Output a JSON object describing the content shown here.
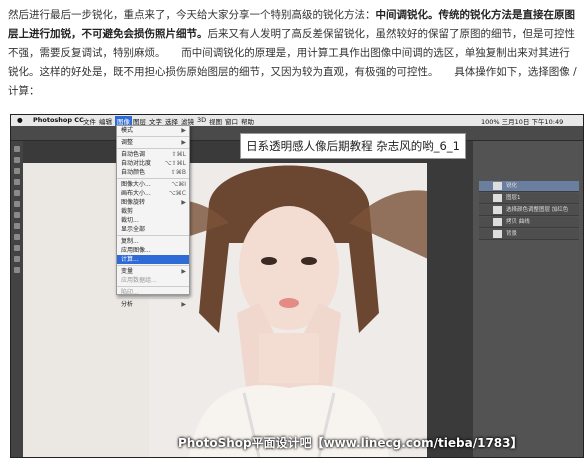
{
  "article": {
    "p1": "然后进行最后一步锐化，重点来了，今天给大家分享一个特别高级的锐化方法：",
    "p1_bold": "中间调锐化。",
    "p1_bold2": "传统的锐化方法是直接在原图层上进行加锐，不可避免会损伤照片细节。",
    "p2": "后来又有人发明了高反差保留锐化，虽然较好的保留了原图的细节，但是可控性不强，需要反复调试，特别麻烦。　　而中间调锐化的原理是，用计算工具作出图像中间调的选区，单独复制出来对其进行锐化。这样的好处是，既不用担心损伤原始图层的细节，又因为较为直观，有极强的可控性。　　具体操作如下，选择图像 / 计算："
  },
  "app": {
    "name": "Photoshop CC",
    "menus": [
      "文件",
      "编辑",
      "图像",
      "图层",
      "文字",
      "选择",
      "滤镜",
      "3D",
      "视图",
      "窗口",
      "帮助"
    ],
    "status_right": "100%  三月10日 下午10:49"
  },
  "image_menu": {
    "items": [
      {
        "label": "模式",
        "shortcut": "▶"
      },
      {
        "label": "调整",
        "shortcut": "▶"
      },
      {
        "label": "自动色调",
        "shortcut": "⇧⌘L"
      },
      {
        "label": "自动对比度",
        "shortcut": "⌥⇧⌘L"
      },
      {
        "label": "自动颜色",
        "shortcut": "⇧⌘B"
      },
      {
        "label": "图像大小...",
        "shortcut": "⌥⌘I"
      },
      {
        "label": "画布大小...",
        "shortcut": "⌥⌘C"
      },
      {
        "label": "图像旋转",
        "shortcut": "▶"
      },
      {
        "label": "裁剪",
        "shortcut": ""
      },
      {
        "label": "裁切...",
        "shortcut": ""
      },
      {
        "label": "显示全部",
        "shortcut": ""
      },
      {
        "label": "复制...",
        "shortcut": ""
      },
      {
        "label": "应用图像...",
        "shortcut": ""
      },
      {
        "label": "计算...",
        "shortcut": ""
      },
      {
        "label": "变量",
        "shortcut": "▶"
      },
      {
        "label": "应用数据组...",
        "shortcut": ""
      },
      {
        "label": "陷印...",
        "shortcut": ""
      },
      {
        "label": "分析",
        "shortcut": "▶"
      }
    ]
  },
  "tutorial_title": "日系透明感人像后期教程 杂志风的哟_6_1",
  "layers": [
    "锐化",
    "图层1",
    "选择颜色调整图层 加红色",
    "拷贝 曲线",
    "背景"
  ],
  "watermark": "PhotoShop平面设计吧【www.linecg.com/tieba/1783】"
}
